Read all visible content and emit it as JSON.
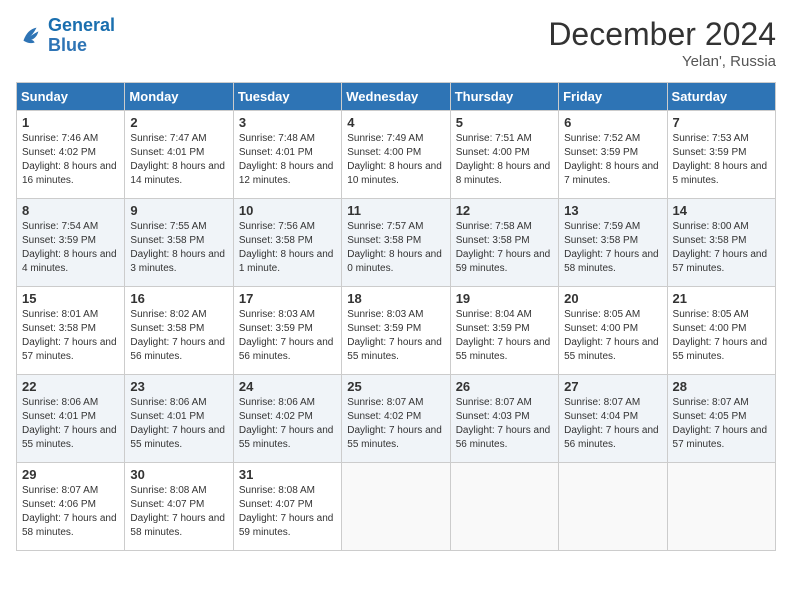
{
  "logo": {
    "text_general": "General",
    "text_blue": "Blue"
  },
  "header": {
    "month": "December 2024",
    "location": "Yelan', Russia"
  },
  "weekdays": [
    "Sunday",
    "Monday",
    "Tuesday",
    "Wednesday",
    "Thursday",
    "Friday",
    "Saturday"
  ],
  "weeks": [
    [
      {
        "day": "1",
        "sunrise": "7:46 AM",
        "sunset": "4:02 PM",
        "daylight": "8 hours and 16 minutes."
      },
      {
        "day": "2",
        "sunrise": "7:47 AM",
        "sunset": "4:01 PM",
        "daylight": "8 hours and 14 minutes."
      },
      {
        "day": "3",
        "sunrise": "7:48 AM",
        "sunset": "4:01 PM",
        "daylight": "8 hours and 12 minutes."
      },
      {
        "day": "4",
        "sunrise": "7:49 AM",
        "sunset": "4:00 PM",
        "daylight": "8 hours and 10 minutes."
      },
      {
        "day": "5",
        "sunrise": "7:51 AM",
        "sunset": "4:00 PM",
        "daylight": "8 hours and 8 minutes."
      },
      {
        "day": "6",
        "sunrise": "7:52 AM",
        "sunset": "3:59 PM",
        "daylight": "8 hours and 7 minutes."
      },
      {
        "day": "7",
        "sunrise": "7:53 AM",
        "sunset": "3:59 PM",
        "daylight": "8 hours and 5 minutes."
      }
    ],
    [
      {
        "day": "8",
        "sunrise": "7:54 AM",
        "sunset": "3:59 PM",
        "daylight": "8 hours and 4 minutes."
      },
      {
        "day": "9",
        "sunrise": "7:55 AM",
        "sunset": "3:58 PM",
        "daylight": "8 hours and 3 minutes."
      },
      {
        "day": "10",
        "sunrise": "7:56 AM",
        "sunset": "3:58 PM",
        "daylight": "8 hours and 1 minute."
      },
      {
        "day": "11",
        "sunrise": "7:57 AM",
        "sunset": "3:58 PM",
        "daylight": "8 hours and 0 minutes."
      },
      {
        "day": "12",
        "sunrise": "7:58 AM",
        "sunset": "3:58 PM",
        "daylight": "7 hours and 59 minutes."
      },
      {
        "day": "13",
        "sunrise": "7:59 AM",
        "sunset": "3:58 PM",
        "daylight": "7 hours and 58 minutes."
      },
      {
        "day": "14",
        "sunrise": "8:00 AM",
        "sunset": "3:58 PM",
        "daylight": "7 hours and 57 minutes."
      }
    ],
    [
      {
        "day": "15",
        "sunrise": "8:01 AM",
        "sunset": "3:58 PM",
        "daylight": "7 hours and 57 minutes."
      },
      {
        "day": "16",
        "sunrise": "8:02 AM",
        "sunset": "3:58 PM",
        "daylight": "7 hours and 56 minutes."
      },
      {
        "day": "17",
        "sunrise": "8:03 AM",
        "sunset": "3:59 PM",
        "daylight": "7 hours and 56 minutes."
      },
      {
        "day": "18",
        "sunrise": "8:03 AM",
        "sunset": "3:59 PM",
        "daylight": "7 hours and 55 minutes."
      },
      {
        "day": "19",
        "sunrise": "8:04 AM",
        "sunset": "3:59 PM",
        "daylight": "7 hours and 55 minutes."
      },
      {
        "day": "20",
        "sunrise": "8:05 AM",
        "sunset": "4:00 PM",
        "daylight": "7 hours and 55 minutes."
      },
      {
        "day": "21",
        "sunrise": "8:05 AM",
        "sunset": "4:00 PM",
        "daylight": "7 hours and 55 minutes."
      }
    ],
    [
      {
        "day": "22",
        "sunrise": "8:06 AM",
        "sunset": "4:01 PM",
        "daylight": "7 hours and 55 minutes."
      },
      {
        "day": "23",
        "sunrise": "8:06 AM",
        "sunset": "4:01 PM",
        "daylight": "7 hours and 55 minutes."
      },
      {
        "day": "24",
        "sunrise": "8:06 AM",
        "sunset": "4:02 PM",
        "daylight": "7 hours and 55 minutes."
      },
      {
        "day": "25",
        "sunrise": "8:07 AM",
        "sunset": "4:02 PM",
        "daylight": "7 hours and 55 minutes."
      },
      {
        "day": "26",
        "sunrise": "8:07 AM",
        "sunset": "4:03 PM",
        "daylight": "7 hours and 56 minutes."
      },
      {
        "day": "27",
        "sunrise": "8:07 AM",
        "sunset": "4:04 PM",
        "daylight": "7 hours and 56 minutes."
      },
      {
        "day": "28",
        "sunrise": "8:07 AM",
        "sunset": "4:05 PM",
        "daylight": "7 hours and 57 minutes."
      }
    ],
    [
      {
        "day": "29",
        "sunrise": "8:07 AM",
        "sunset": "4:06 PM",
        "daylight": "7 hours and 58 minutes."
      },
      {
        "day": "30",
        "sunrise": "8:08 AM",
        "sunset": "4:07 PM",
        "daylight": "7 hours and 58 minutes."
      },
      {
        "day": "31",
        "sunrise": "8:08 AM",
        "sunset": "4:07 PM",
        "daylight": "7 hours and 59 minutes."
      },
      null,
      null,
      null,
      null
    ]
  ]
}
